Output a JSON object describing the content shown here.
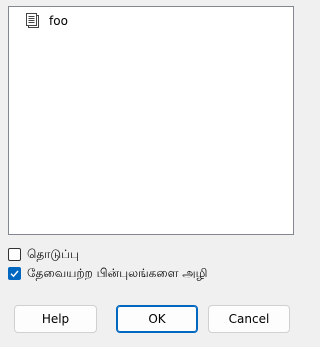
{
  "list": {
    "items": [
      {
        "label": "foo",
        "icon": "document-icon"
      }
    ]
  },
  "options": {
    "option1": {
      "label": "தொடுப்பு",
      "checked": false
    },
    "option2": {
      "label": "தேவையற்ற பின்புலங்களை அழி",
      "checked": true
    }
  },
  "buttons": {
    "help": "Help",
    "ok": "OK",
    "cancel": "Cancel"
  },
  "colors": {
    "accent": "#0067c0",
    "background": "#f0f0f0"
  }
}
